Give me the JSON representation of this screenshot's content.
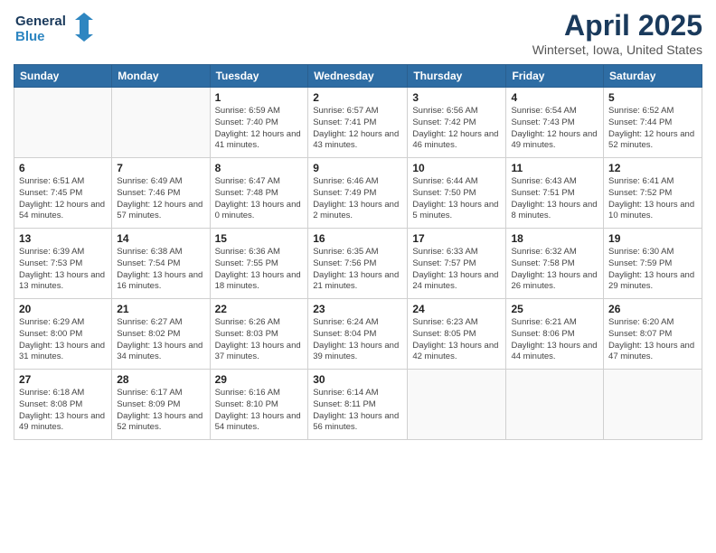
{
  "logo": {
    "line1": "General",
    "line2": "Blue"
  },
  "title": "April 2025",
  "subtitle": "Winterset, Iowa, United States",
  "weekdays": [
    "Sunday",
    "Monday",
    "Tuesday",
    "Wednesday",
    "Thursday",
    "Friday",
    "Saturday"
  ],
  "weeks": [
    [
      {
        "day": "",
        "sunrise": "",
        "sunset": "",
        "daylight": ""
      },
      {
        "day": "",
        "sunrise": "",
        "sunset": "",
        "daylight": ""
      },
      {
        "day": "1",
        "sunrise": "Sunrise: 6:59 AM",
        "sunset": "Sunset: 7:40 PM",
        "daylight": "Daylight: 12 hours and 41 minutes."
      },
      {
        "day": "2",
        "sunrise": "Sunrise: 6:57 AM",
        "sunset": "Sunset: 7:41 PM",
        "daylight": "Daylight: 12 hours and 43 minutes."
      },
      {
        "day": "3",
        "sunrise": "Sunrise: 6:56 AM",
        "sunset": "Sunset: 7:42 PM",
        "daylight": "Daylight: 12 hours and 46 minutes."
      },
      {
        "day": "4",
        "sunrise": "Sunrise: 6:54 AM",
        "sunset": "Sunset: 7:43 PM",
        "daylight": "Daylight: 12 hours and 49 minutes."
      },
      {
        "day": "5",
        "sunrise": "Sunrise: 6:52 AM",
        "sunset": "Sunset: 7:44 PM",
        "daylight": "Daylight: 12 hours and 52 minutes."
      }
    ],
    [
      {
        "day": "6",
        "sunrise": "Sunrise: 6:51 AM",
        "sunset": "Sunset: 7:45 PM",
        "daylight": "Daylight: 12 hours and 54 minutes."
      },
      {
        "day": "7",
        "sunrise": "Sunrise: 6:49 AM",
        "sunset": "Sunset: 7:46 PM",
        "daylight": "Daylight: 12 hours and 57 minutes."
      },
      {
        "day": "8",
        "sunrise": "Sunrise: 6:47 AM",
        "sunset": "Sunset: 7:48 PM",
        "daylight": "Daylight: 13 hours and 0 minutes."
      },
      {
        "day": "9",
        "sunrise": "Sunrise: 6:46 AM",
        "sunset": "Sunset: 7:49 PM",
        "daylight": "Daylight: 13 hours and 2 minutes."
      },
      {
        "day": "10",
        "sunrise": "Sunrise: 6:44 AM",
        "sunset": "Sunset: 7:50 PM",
        "daylight": "Daylight: 13 hours and 5 minutes."
      },
      {
        "day": "11",
        "sunrise": "Sunrise: 6:43 AM",
        "sunset": "Sunset: 7:51 PM",
        "daylight": "Daylight: 13 hours and 8 minutes."
      },
      {
        "day": "12",
        "sunrise": "Sunrise: 6:41 AM",
        "sunset": "Sunset: 7:52 PM",
        "daylight": "Daylight: 13 hours and 10 minutes."
      }
    ],
    [
      {
        "day": "13",
        "sunrise": "Sunrise: 6:39 AM",
        "sunset": "Sunset: 7:53 PM",
        "daylight": "Daylight: 13 hours and 13 minutes."
      },
      {
        "day": "14",
        "sunrise": "Sunrise: 6:38 AM",
        "sunset": "Sunset: 7:54 PM",
        "daylight": "Daylight: 13 hours and 16 minutes."
      },
      {
        "day": "15",
        "sunrise": "Sunrise: 6:36 AM",
        "sunset": "Sunset: 7:55 PM",
        "daylight": "Daylight: 13 hours and 18 minutes."
      },
      {
        "day": "16",
        "sunrise": "Sunrise: 6:35 AM",
        "sunset": "Sunset: 7:56 PM",
        "daylight": "Daylight: 13 hours and 21 minutes."
      },
      {
        "day": "17",
        "sunrise": "Sunrise: 6:33 AM",
        "sunset": "Sunset: 7:57 PM",
        "daylight": "Daylight: 13 hours and 24 minutes."
      },
      {
        "day": "18",
        "sunrise": "Sunrise: 6:32 AM",
        "sunset": "Sunset: 7:58 PM",
        "daylight": "Daylight: 13 hours and 26 minutes."
      },
      {
        "day": "19",
        "sunrise": "Sunrise: 6:30 AM",
        "sunset": "Sunset: 7:59 PM",
        "daylight": "Daylight: 13 hours and 29 minutes."
      }
    ],
    [
      {
        "day": "20",
        "sunrise": "Sunrise: 6:29 AM",
        "sunset": "Sunset: 8:00 PM",
        "daylight": "Daylight: 13 hours and 31 minutes."
      },
      {
        "day": "21",
        "sunrise": "Sunrise: 6:27 AM",
        "sunset": "Sunset: 8:02 PM",
        "daylight": "Daylight: 13 hours and 34 minutes."
      },
      {
        "day": "22",
        "sunrise": "Sunrise: 6:26 AM",
        "sunset": "Sunset: 8:03 PM",
        "daylight": "Daylight: 13 hours and 37 minutes."
      },
      {
        "day": "23",
        "sunrise": "Sunrise: 6:24 AM",
        "sunset": "Sunset: 8:04 PM",
        "daylight": "Daylight: 13 hours and 39 minutes."
      },
      {
        "day": "24",
        "sunrise": "Sunrise: 6:23 AM",
        "sunset": "Sunset: 8:05 PM",
        "daylight": "Daylight: 13 hours and 42 minutes."
      },
      {
        "day": "25",
        "sunrise": "Sunrise: 6:21 AM",
        "sunset": "Sunset: 8:06 PM",
        "daylight": "Daylight: 13 hours and 44 minutes."
      },
      {
        "day": "26",
        "sunrise": "Sunrise: 6:20 AM",
        "sunset": "Sunset: 8:07 PM",
        "daylight": "Daylight: 13 hours and 47 minutes."
      }
    ],
    [
      {
        "day": "27",
        "sunrise": "Sunrise: 6:18 AM",
        "sunset": "Sunset: 8:08 PM",
        "daylight": "Daylight: 13 hours and 49 minutes."
      },
      {
        "day": "28",
        "sunrise": "Sunrise: 6:17 AM",
        "sunset": "Sunset: 8:09 PM",
        "daylight": "Daylight: 13 hours and 52 minutes."
      },
      {
        "day": "29",
        "sunrise": "Sunrise: 6:16 AM",
        "sunset": "Sunset: 8:10 PM",
        "daylight": "Daylight: 13 hours and 54 minutes."
      },
      {
        "day": "30",
        "sunrise": "Sunrise: 6:14 AM",
        "sunset": "Sunset: 8:11 PM",
        "daylight": "Daylight: 13 hours and 56 minutes."
      },
      {
        "day": "",
        "sunrise": "",
        "sunset": "",
        "daylight": ""
      },
      {
        "day": "",
        "sunrise": "",
        "sunset": "",
        "daylight": ""
      },
      {
        "day": "",
        "sunrise": "",
        "sunset": "",
        "daylight": ""
      }
    ]
  ]
}
